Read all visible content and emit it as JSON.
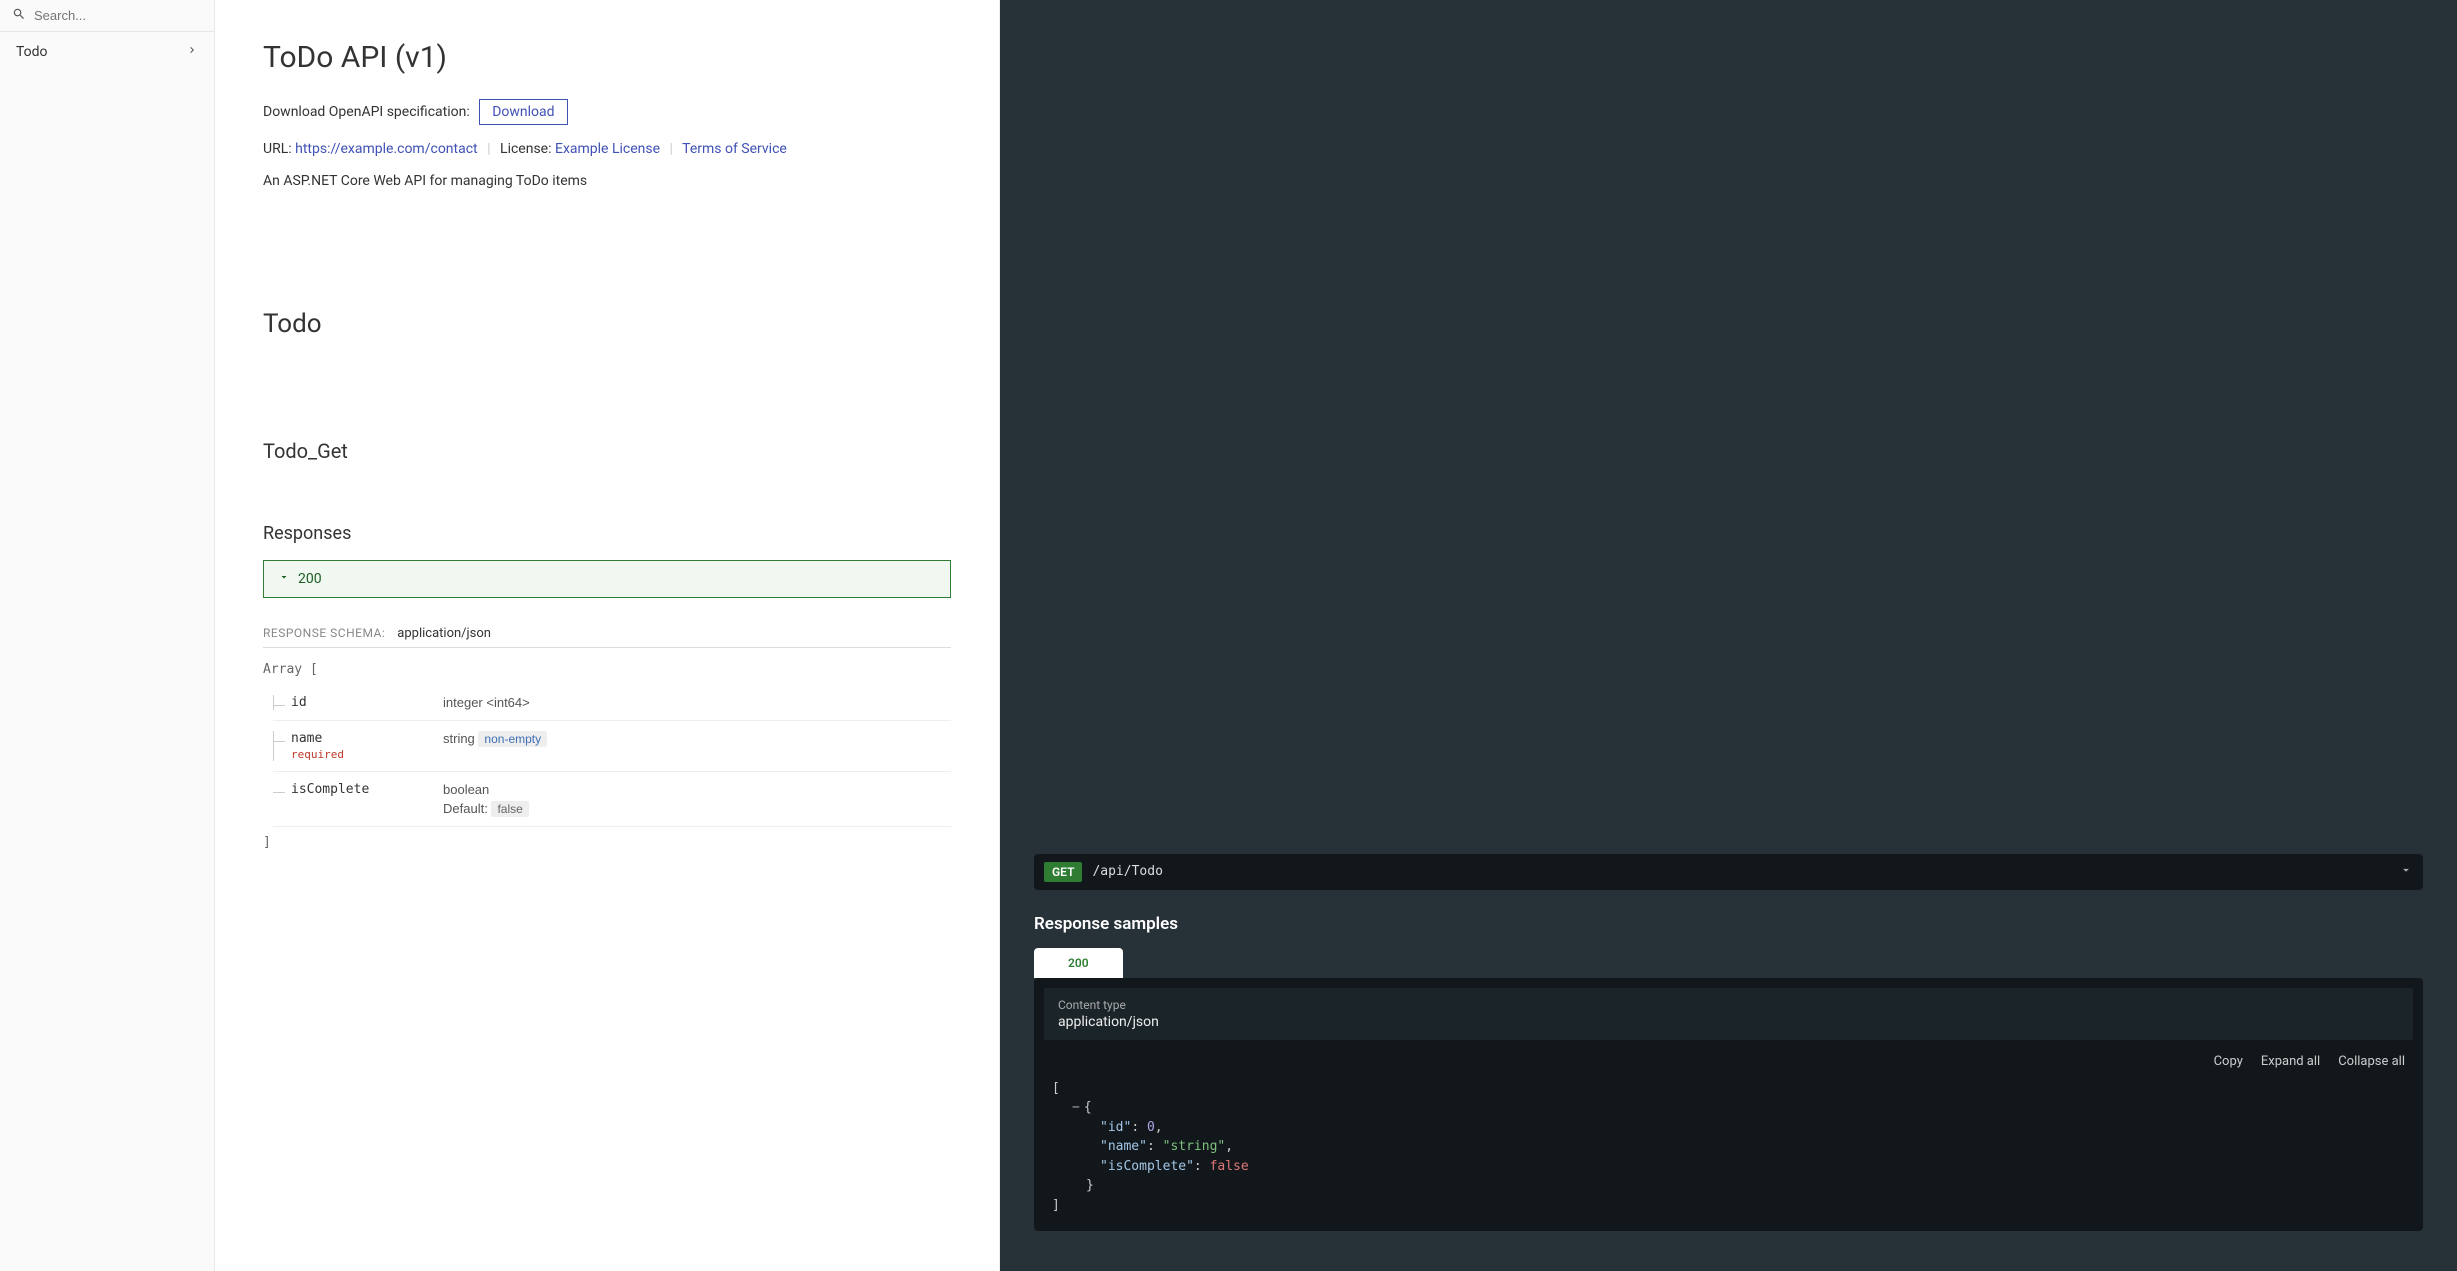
{
  "sidebar": {
    "searchPlaceholder": "Search...",
    "items": [
      {
        "label": "Todo"
      }
    ]
  },
  "header": {
    "title": "ToDo API (v1)",
    "downloadLabel": "Download OpenAPI specification:",
    "downloadBtn": "Download",
    "urlLabel": "URL: ",
    "url": "https://example.com/contact",
    "licenseLabel": "License: ",
    "license": "Example License",
    "tos": "Terms of Service",
    "description": "An ASP.NET Core Web API for managing ToDo items"
  },
  "section": {
    "tag": "Todo",
    "operation": "Todo_Get"
  },
  "responses": {
    "heading": "Responses",
    "code": "200",
    "schemaLabel": "RESPONSE SCHEMA:",
    "schemaType": "application/json",
    "arrayOpen": "Array [",
    "arrayClose": "]",
    "props": [
      {
        "name": "id",
        "type": "integer <int64>",
        "required": false
      },
      {
        "name": "name",
        "type": "string",
        "badge": "non-empty",
        "required": true
      },
      {
        "name": "isComplete",
        "type": "boolean",
        "defaultLabel": "Default:",
        "default": "false",
        "required": false
      }
    ],
    "requiredLabel": "required"
  },
  "rightPanel": {
    "method": "GET",
    "path": "/api/Todo",
    "samplesHeading": "Response samples",
    "tab": "200",
    "contentTypeLabel": "Content type",
    "contentType": "application/json",
    "actions": {
      "copy": "Copy",
      "expand": "Expand all",
      "collapse": "Collapse all"
    },
    "sample": {
      "id_key": "\"id\"",
      "id_val": "0",
      "name_key": "\"name\"",
      "name_val": "\"string\"",
      "isc_key": "\"isComplete\"",
      "isc_val": "false"
    }
  }
}
